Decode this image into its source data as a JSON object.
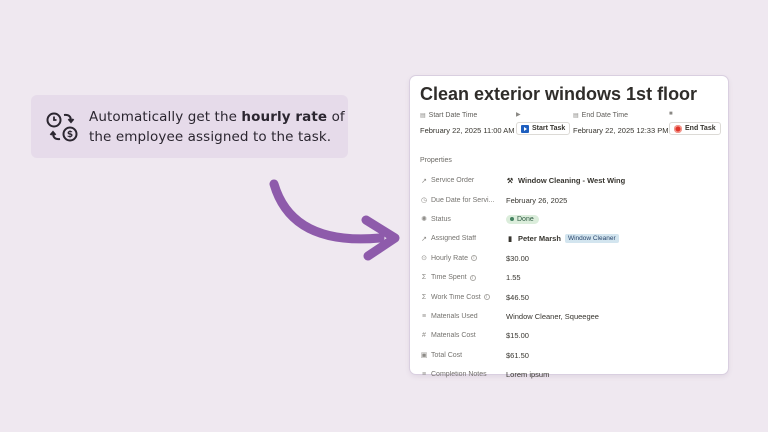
{
  "callout": {
    "text_before": "Automatically get the ",
    "text_bold": "hourly rate",
    "text_after": " of the employee assigned to the task."
  },
  "card": {
    "title": "Clean exterior windows 1st floor",
    "start": {
      "label": "Start Date Time",
      "value": "February 22, 2025 11:00 AM",
      "button_label": "Start Task"
    },
    "end": {
      "label": "End Date Time",
      "value": "February 22, 2025 12:33 PM",
      "button_label": "End Task"
    },
    "properties_heading": "Properties",
    "properties": [
      {
        "label": "Service Order",
        "value": "Window Cleaning - West Wing",
        "icon": "relation-arrow-icon"
      },
      {
        "label": "Due Date for Servi...",
        "value": "February 26, 2025",
        "icon": "calendar-clock-icon"
      },
      {
        "label": "Status",
        "value": "Done",
        "icon": "status-icon"
      },
      {
        "label": "Assigned Staff",
        "value": "Peter Marsh",
        "tag": "Window Cleaner",
        "icon": "relation-arrow-icon"
      },
      {
        "label": "Hourly Rate",
        "value": "$30.00",
        "icon": "rollup-icon"
      },
      {
        "label": "Time Spent",
        "value": "1.55",
        "icon": "formula-icon"
      },
      {
        "label": "Work Time Cost",
        "value": "$46.50",
        "icon": "formula-icon"
      },
      {
        "label": "Materials Used",
        "value": "Window Cleaner, Squeegee",
        "icon": "text-lines-icon"
      },
      {
        "label": "Materials Cost",
        "value": "$15.00",
        "icon": "number-hash-icon"
      },
      {
        "label": "Total Cost",
        "value": "$61.50",
        "icon": "money-icon"
      },
      {
        "label": "Completion Notes",
        "value": "Lorem ipsum",
        "icon": "text-lines-icon"
      }
    ]
  },
  "colors": {
    "background": "#efe8f0",
    "callout_bg": "#e6dbea",
    "arrow": "#8e5bab",
    "status_green": "#dbeddb",
    "tag_blue": "#d3e5ef"
  }
}
